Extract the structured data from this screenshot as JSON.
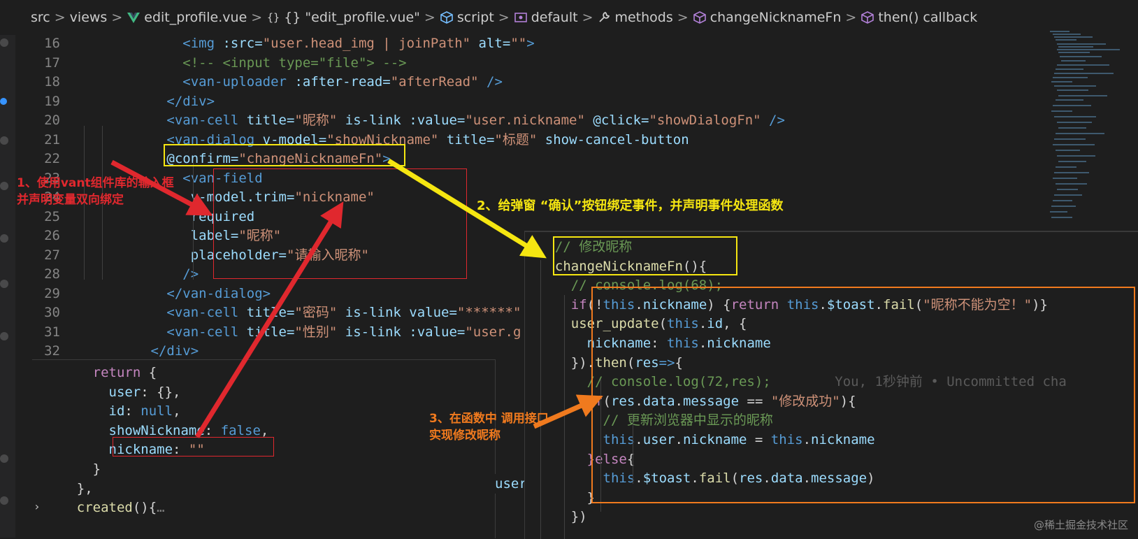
{
  "breadcrumb": {
    "items": [
      "src",
      "views",
      "edit_profile.vue",
      "{} \"edit_profile.vue\"",
      "script",
      "default",
      "methods",
      "changeNicknameFn",
      "then() callback"
    ],
    "icons": [
      "",
      "",
      "vue-icon",
      "braces-icon",
      "cube-icon",
      "module-icon",
      "wrench-icon",
      "method-cube-icon",
      "method-cube-icon"
    ]
  },
  "editor": {
    "lines": [
      {
        "n": "16",
        "indent": "        ",
        "tokens": [
          [
            "tag",
            "<img "
          ],
          [
            "attr",
            ":src="
          ],
          [
            "str",
            "\"user.head_img | joinPath\""
          ],
          [
            "attr",
            " alt="
          ],
          [
            "str",
            "\"\""
          ],
          [
            "tag",
            ">"
          ]
        ]
      },
      {
        "n": "17",
        "indent": "        ",
        "tokens": [
          [
            "cmt",
            "<!-- <input type=\"file\"> -->"
          ]
        ]
      },
      {
        "n": "18",
        "indent": "        ",
        "tokens": [
          [
            "tag",
            "<van-uploader "
          ],
          [
            "attr",
            ":after-read="
          ],
          [
            "str",
            "\"afterRead\""
          ],
          [
            "tag",
            " />"
          ]
        ]
      },
      {
        "n": "19",
        "indent": "      ",
        "tokens": [
          [
            "tag",
            "</div>"
          ]
        ]
      },
      {
        "n": "20",
        "indent": "      ",
        "tokens": [
          [
            "tag",
            "<van-cell "
          ],
          [
            "attr",
            "title="
          ],
          [
            "str",
            "\"昵称\""
          ],
          [
            "attr",
            " is-link :value="
          ],
          [
            "str",
            "\"user.nickname\""
          ],
          [
            "attr",
            " @click="
          ],
          [
            "str",
            "\"showDialogFn\""
          ],
          [
            "tag",
            " />"
          ]
        ]
      },
      {
        "n": "21",
        "indent": "      ",
        "tokens": [
          [
            "tag",
            "<van-dialog "
          ],
          [
            "attr",
            "v-model="
          ],
          [
            "str",
            "\"showNickname\""
          ],
          [
            "attr",
            " title="
          ],
          [
            "str",
            "\"标题\""
          ],
          [
            "attr",
            " show-cancel-button"
          ]
        ]
      },
      {
        "n": "22",
        "indent": "      ",
        "tokens": [
          [
            "attr",
            "@confirm="
          ],
          [
            "str",
            "\"changeNicknameFn\""
          ],
          [
            "tag",
            ">"
          ]
        ]
      },
      {
        "n": "23",
        "indent": "        ",
        "tokens": [
          [
            "tag",
            "<van-field"
          ]
        ]
      },
      {
        "n": "24",
        "indent": "         ",
        "tokens": [
          [
            "attr",
            "v-model.trim="
          ],
          [
            "str",
            "\"nickname\""
          ]
        ]
      },
      {
        "n": "25",
        "indent": "         ",
        "tokens": [
          [
            "attr",
            "required"
          ]
        ]
      },
      {
        "n": "26",
        "indent": "         ",
        "tokens": [
          [
            "attr",
            "label="
          ],
          [
            "str",
            "\"昵称\""
          ]
        ]
      },
      {
        "n": "27",
        "indent": "         ",
        "tokens": [
          [
            "attr",
            "placeholder="
          ],
          [
            "str",
            "\"请输入昵称\""
          ]
        ]
      },
      {
        "n": "28",
        "indent": "        ",
        "tokens": [
          [
            "tag",
            "/>"
          ]
        ]
      },
      {
        "n": "29",
        "indent": "      ",
        "tokens": [
          [
            "tag",
            "</van-dialog>"
          ]
        ]
      },
      {
        "n": "30",
        "indent": "      ",
        "tokens": [
          [
            "tag",
            "<van-cell "
          ],
          [
            "attr",
            "title="
          ],
          [
            "str",
            "\"密码\""
          ],
          [
            "attr",
            " is-link value="
          ],
          [
            "str",
            "\"******\""
          ]
        ]
      },
      {
        "n": "31",
        "indent": "      ",
        "tokens": [
          [
            "tag",
            "<van-cell "
          ],
          [
            "attr",
            "title="
          ],
          [
            "str",
            "\"性别\""
          ],
          [
            "attr",
            " is-link :value="
          ],
          [
            "str",
            "\"user.g"
          ]
        ]
      },
      {
        "n": "32",
        "indent": "    ",
        "tokens": [
          [
            "tag",
            "</div>"
          ]
        ]
      }
    ]
  },
  "left_panel": {
    "lines": [
      {
        "indent": "    ",
        "tokens": [
          [
            "kw",
            "return"
          ],
          [
            "plain",
            " {"
          ]
        ]
      },
      {
        "indent": "      ",
        "tokens": [
          [
            "var",
            "user"
          ],
          [
            "plain",
            ": {},"
          ]
        ]
      },
      {
        "indent": "      ",
        "tokens": [
          [
            "var",
            "id"
          ],
          [
            "plain",
            ": "
          ],
          [
            "kwb",
            "null"
          ],
          [
            "plain",
            ","
          ]
        ]
      },
      {
        "indent": "      ",
        "tokens": [
          [
            "var",
            "showNickname"
          ],
          [
            "plain",
            ": "
          ],
          [
            "kwb",
            "false"
          ],
          [
            "plain",
            ","
          ]
        ]
      },
      {
        "indent": "      ",
        "tokens": [
          [
            "var",
            "nickname"
          ],
          [
            "plain",
            ": "
          ],
          [
            "str",
            "\"\""
          ]
        ]
      },
      {
        "indent": "    ",
        "tokens": [
          [
            "plain",
            "}"
          ]
        ]
      },
      {
        "indent": "  ",
        "tokens": [
          [
            "plain",
            "},"
          ]
        ]
      },
      {
        "indent": "  ",
        "tokens": [
          [
            "fn",
            "created"
          ],
          [
            "plain",
            "(){"
          ],
          [
            "punct",
            "…"
          ]
        ]
      }
    ],
    "fragment": "user"
  },
  "right_panel": {
    "lines": [
      {
        "indent": "  ",
        "tokens": [
          [
            "cmt",
            "// 修改昵称"
          ]
        ]
      },
      {
        "indent": "  ",
        "tokens": [
          [
            "fn",
            "changeNicknameFn"
          ],
          [
            "plain",
            "(){"
          ]
        ]
      },
      {
        "indent": "    ",
        "tokens": [
          [
            "cmt",
            "// console.log(68);"
          ]
        ]
      },
      {
        "indent": "    ",
        "tokens": [
          [
            "kw",
            "if"
          ],
          [
            "plain",
            "(!"
          ],
          [
            "kwb",
            "this"
          ],
          [
            "plain",
            "."
          ],
          [
            "var",
            "nickname"
          ],
          [
            "plain",
            ") {"
          ],
          [
            "kw",
            "return "
          ],
          [
            "kwb",
            "this"
          ],
          [
            "plain",
            "."
          ],
          [
            "var",
            "$toast"
          ],
          [
            "plain",
            "."
          ],
          [
            "fn",
            "fail"
          ],
          [
            "plain",
            "("
          ],
          [
            "str",
            "\"昵称不能为空！\""
          ],
          [
            "plain",
            ")}"
          ]
        ]
      },
      {
        "indent": "    ",
        "tokens": [
          [
            "fn",
            "user_update"
          ],
          [
            "plain",
            "("
          ],
          [
            "kwb",
            "this"
          ],
          [
            "plain",
            "."
          ],
          [
            "var",
            "id"
          ],
          [
            "plain",
            ", {"
          ]
        ]
      },
      {
        "indent": "      ",
        "tokens": [
          [
            "var",
            "nickname"
          ],
          [
            "plain",
            ": "
          ],
          [
            "kwb",
            "this"
          ],
          [
            "plain",
            "."
          ],
          [
            "var",
            "nickname"
          ]
        ]
      },
      {
        "indent": "    ",
        "tokens": [
          [
            "plain",
            "})."
          ],
          [
            "fn",
            "then"
          ],
          [
            "plain",
            "("
          ],
          [
            "var",
            "res"
          ],
          [
            "kwb",
            "=>"
          ],
          [
            "plain",
            "{"
          ]
        ]
      },
      {
        "indent": "      ",
        "tokens": [
          [
            "cmt",
            "// console.log(72,res);"
          ]
        ]
      },
      {
        "indent": "      ",
        "tokens": [
          [
            "kw",
            "if"
          ],
          [
            "plain",
            "("
          ],
          [
            "var",
            "res"
          ],
          [
            "plain",
            "."
          ],
          [
            "var",
            "data"
          ],
          [
            "plain",
            "."
          ],
          [
            "var",
            "message"
          ],
          [
            "plain",
            " == "
          ],
          [
            "str",
            "\"修改成功\""
          ],
          [
            "plain",
            "){"
          ]
        ]
      },
      {
        "indent": "        ",
        "tokens": [
          [
            "cmt",
            "// 更新浏览器中显示的昵称"
          ]
        ]
      },
      {
        "indent": "        ",
        "tokens": [
          [
            "kwb",
            "this"
          ],
          [
            "plain",
            "."
          ],
          [
            "var",
            "user"
          ],
          [
            "plain",
            "."
          ],
          [
            "var",
            "nickname"
          ],
          [
            "plain",
            " = "
          ],
          [
            "kwb",
            "this"
          ],
          [
            "plain",
            "."
          ],
          [
            "var",
            "nickname"
          ]
        ]
      },
      {
        "indent": "      ",
        "tokens": [
          [
            "kw",
            "}else"
          ],
          [
            "plain",
            "{"
          ]
        ]
      },
      {
        "indent": "        ",
        "tokens": [
          [
            "kwb",
            "this"
          ],
          [
            "plain",
            "."
          ],
          [
            "var",
            "$toast"
          ],
          [
            "plain",
            "."
          ],
          [
            "fn",
            "fail"
          ],
          [
            "plain",
            "("
          ],
          [
            "var",
            "res"
          ],
          [
            "plain",
            "."
          ],
          [
            "var",
            "data"
          ],
          [
            "plain",
            "."
          ],
          [
            "var",
            "message"
          ],
          [
            "plain",
            ")"
          ]
        ]
      },
      {
        "indent": "      ",
        "tokens": [
          [
            "plain",
            "}"
          ]
        ]
      },
      {
        "indent": "    ",
        "tokens": [
          [
            "plain",
            "})"
          ]
        ]
      }
    ],
    "blame": "You, 1秒钟前 • Uncommitted cha"
  },
  "annotations": {
    "note1": "1、使用vant组件库的输入框\n并声明变量双向绑定",
    "note2": "2、给弹窗 “确认”按钮绑定事件，并声明事件处理函数",
    "note3": "3、在函数中 调用接口\n实现修改昵称"
  },
  "colors": {
    "red": "#e0282e",
    "yellow": "#f5e611",
    "orange": "#f07a1e"
  },
  "watermark": "@稀土掘金技术社区"
}
